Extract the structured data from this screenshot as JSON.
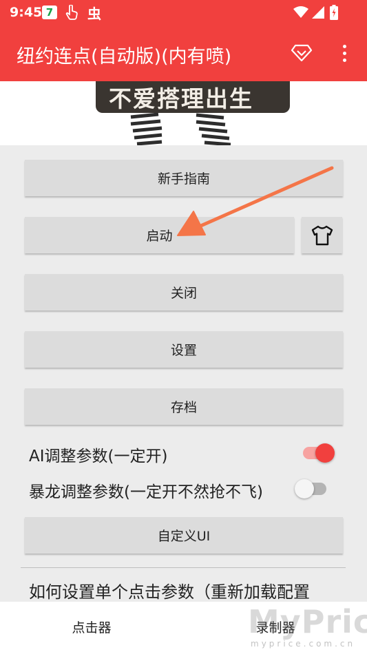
{
  "status_bar": {
    "time": "9:45",
    "badge": "7",
    "bug_glyph": "虫"
  },
  "app_bar": {
    "title": "纽约连点(自动版)(内有喷)"
  },
  "banner": {
    "text": "不爱搭理出生"
  },
  "buttons": {
    "guide": "新手指南",
    "start": "启动",
    "close": "关闭",
    "settings": "设置",
    "save": "存档",
    "custom_ui": "自定义UI"
  },
  "switches": [
    {
      "label": "AI调整参数(一定开)",
      "on": true
    },
    {
      "label": "暴龙调整参数(一定开不然抢不飞)",
      "on": false
    }
  ],
  "help_text": "如何设置单个点击参数（重新加载配置",
  "bottom_nav": {
    "tabs": [
      "点击器",
      "录制器"
    ]
  },
  "watermark": {
    "main": "MyPrice",
    "sub": "myprice.com.cn"
  },
  "colors": {
    "accent": "#f1403e",
    "annotation_arrow": "#f47548"
  }
}
